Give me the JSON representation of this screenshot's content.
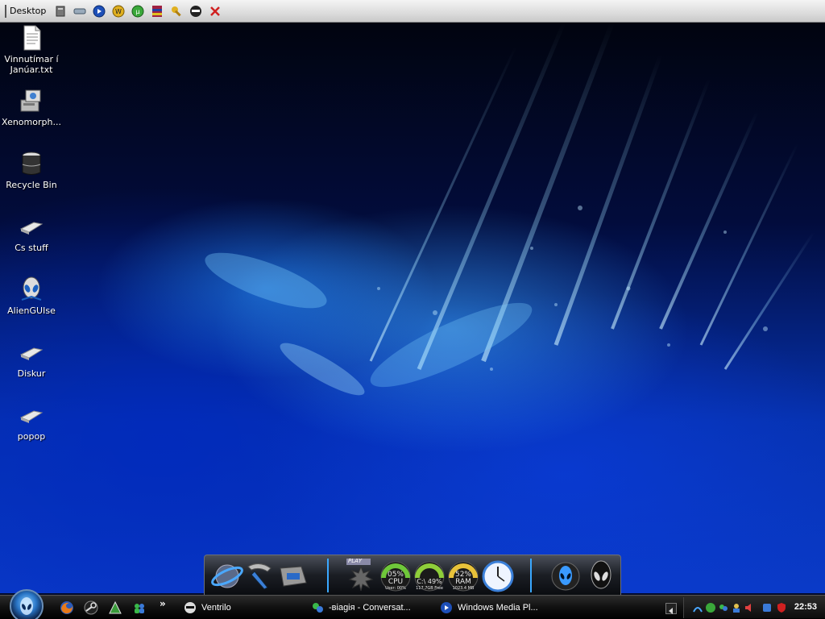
{
  "toolbar": {
    "label": "Desktop",
    "icons": [
      "drive-icon",
      "network-icon",
      "media-player-icon",
      "winamp-icon",
      "utorrent-icon",
      "archive-icon",
      "tools-icon",
      "ventrilo-icon",
      "close-icon"
    ]
  },
  "desktop_icons": [
    {
      "label": "Vinnutímar í Janúar.txt",
      "icon": "text-file-icon"
    },
    {
      "label": "Xenomorph...",
      "icon": "installer-icon"
    },
    {
      "label": "Recycle Bin",
      "icon": "recycle-bin-icon"
    },
    {
      "label": "Cs stuff",
      "icon": "folder-icon"
    },
    {
      "label": "AlienGUIse",
      "icon": "alien-icon"
    },
    {
      "label": "Diskur",
      "icon": "folder-icon"
    },
    {
      "label": "popop",
      "icon": "folder-icon"
    }
  ],
  "dock": {
    "badge": "PLAY",
    "cpu": {
      "percent": "05%",
      "label": "CPU",
      "sub": "User: 00%"
    },
    "disk": {
      "label": "C:\\ 49%",
      "sub": "117.7GB Free"
    },
    "ram": {
      "percent": "52%",
      "label": "RAM",
      "sub": "1023.4 MB"
    }
  },
  "taskbar": {
    "quick_launch": [
      "firefox-icon",
      "steam-icon",
      "winamp-icon",
      "msn-icon"
    ],
    "chevron": "»",
    "tasks": [
      {
        "label": "Ventrilo",
        "icon": "ventrilo-icon"
      },
      {
        "label": "-віagія - Conversat...",
        "icon": "msn-icon"
      },
      {
        "label": "Windows Media Pl...",
        "icon": "media-player-icon"
      }
    ],
    "clock": "22:53"
  },
  "colors": {
    "wallpaper_blue": "#0a3ac8",
    "taskbar_bg": "#101010",
    "gauge_green": "#6fc83a",
    "gauge_yellow": "#e8c23a"
  }
}
